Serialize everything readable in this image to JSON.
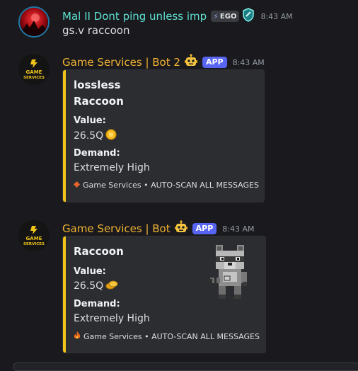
{
  "messages": [
    {
      "username": "Mal II Dont ping unless imp",
      "username_color": "#5ee0d0",
      "badge_text": "EGO",
      "timestamp": "8:43 AM",
      "content": "gs.v raccoon"
    },
    {
      "username": "Game Services | Bot 2",
      "username_color": "#f0b232",
      "app_tag": "APP",
      "timestamp": "8:43 AM",
      "embed": {
        "line1": "lossless",
        "title": "Raccoon",
        "value_label": "Value:",
        "value": "26.5Q",
        "demand_label": "Demand:",
        "demand": "Extremely High",
        "footer": "Game Services • AUTO-SCAN ALL MESSAGES"
      }
    },
    {
      "username": "Game Services | Bot",
      "username_color": "#f0b232",
      "app_tag": "APP",
      "timestamp": "8:43 AM",
      "embed": {
        "title": "Raccoon",
        "value_label": "Value:",
        "value": "26.5Q",
        "demand_label": "Demand:",
        "demand": "Extremely High",
        "footer": "Game Services • AUTO-SCAN ALL MESSAGES"
      }
    }
  ],
  "avatar_logo": {
    "line1": "GAME",
    "line2": "SERVICES"
  },
  "colors": {
    "embed_bar": "#f0c419",
    "app_tag": "#5865f2",
    "background": "#1a1a1e"
  },
  "icons": [
    "ego-bolt-icon",
    "shield-badge-icon",
    "robot-emoji-icon",
    "coin-icon",
    "diamond-icon",
    "fire-icon",
    "raccoon-pet-image"
  ]
}
